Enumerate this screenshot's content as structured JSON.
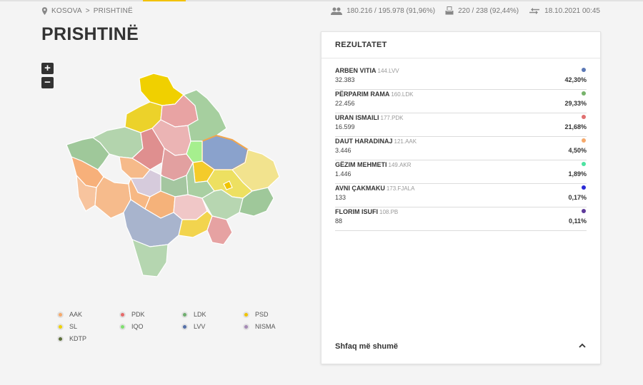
{
  "breadcrumb": {
    "root": "KOSOVA",
    "separator": ">",
    "current": "PRISHTINË"
  },
  "stats": {
    "voters": "180.216 / 195.978 (91,96%)",
    "polling": "220 / 238 (92,44%)",
    "updated": "18.10.2021 00:45"
  },
  "page_title": "PRISHTINË",
  "zoom": {
    "in": "+",
    "out": "−"
  },
  "legend": [
    {
      "label": "AAK",
      "color": "#f6a96b"
    },
    {
      "label": "PDK",
      "color": "#e66a6a"
    },
    {
      "label": "LDK",
      "color": "#6fae6f"
    },
    {
      "label": "PSD",
      "color": "#f0c400"
    },
    {
      "label": "SL",
      "color": "#f0d200"
    },
    {
      "label": "IQO",
      "color": "#7ee06e"
    },
    {
      "label": "LVV",
      "color": "#5570a8"
    },
    {
      "label": "NISMA",
      "color": "#a58ab5"
    },
    {
      "label": "KDTP",
      "color": "#5c6e3a"
    }
  ],
  "results": {
    "title": "REZULTATET",
    "candidates": [
      {
        "name": "ARBEN VITIA",
        "list": "144.LVV",
        "votes": "32.383",
        "percent": "42,30%",
        "color": "#5b78b5"
      },
      {
        "name": "PËRPARIM RAMA",
        "list": "160.LDK",
        "votes": "22.456",
        "percent": "29,33%",
        "color": "#77b36b"
      },
      {
        "name": "URAN ISMAILI",
        "list": "177.PDK",
        "votes": "16.599",
        "percent": "21,68%",
        "color": "#e07070"
      },
      {
        "name": "DAUT HARADINAJ",
        "list": "121.AAK",
        "votes": "3.446",
        "percent": "4,50%",
        "color": "#f6a96b"
      },
      {
        "name": "GËZIM MEHMETI",
        "list": "149.AKR",
        "votes": "1.446",
        "percent": "1,89%",
        "color": "#4de3a2"
      },
      {
        "name": "AVNI ÇAKMAKU",
        "list": "173.FJALA",
        "votes": "133",
        "percent": "0,17%",
        "color": "#2b2bd6"
      },
      {
        "name": "FLORIM ISUFI",
        "list": "108.PB",
        "votes": "88",
        "percent": "0,11%",
        "color": "#5e3a9a"
      }
    ],
    "show_more": "Shfaq më shumë"
  }
}
